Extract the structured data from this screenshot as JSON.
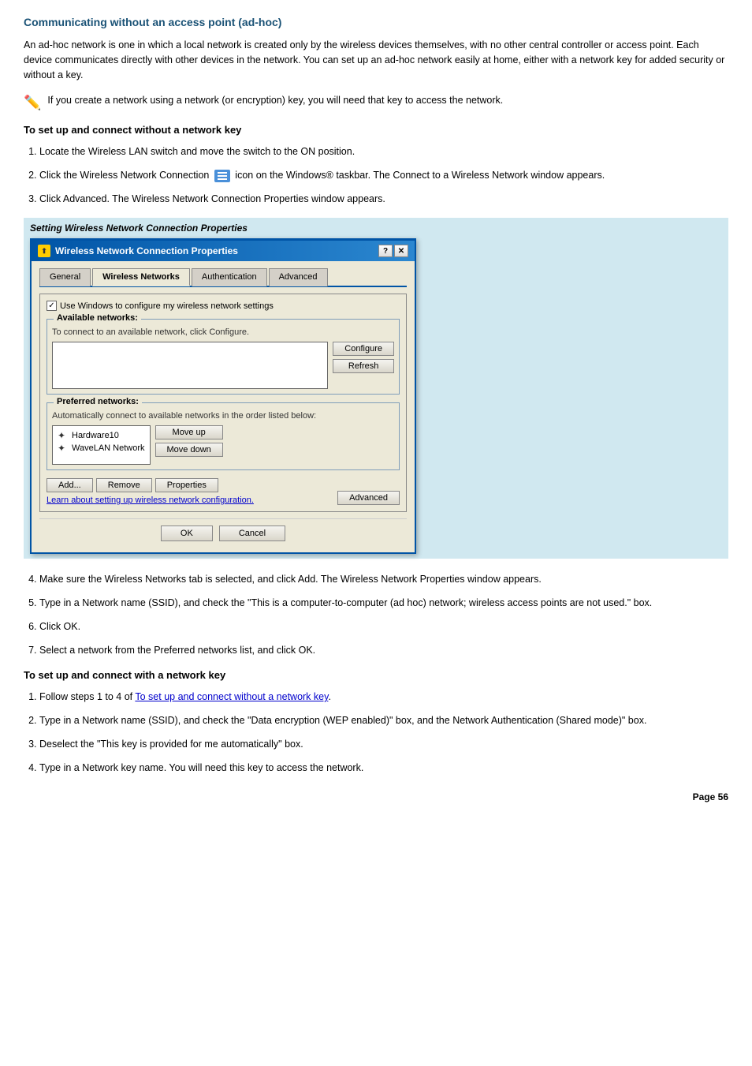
{
  "page": {
    "title": "Communicating without an access point (ad-hoc)",
    "intro": "An ad-hoc network is one in which a local network is created only by the wireless devices themselves, with no other central controller or access point. Each device communicates directly with other devices in the network. You can set up an ad-hoc network easily at home, either with a network key for added security or without a key.",
    "note": "If you create a network using a network (or encryption) key, you will need that key to access the network.",
    "section1_title": "To set up and connect without a network key",
    "steps1": [
      "Locate the Wireless LAN switch and move the switch to the ON position.",
      "Click the Wireless Network Connection  icon on the Windows® taskbar. The Connect to a Wireless Network window appears.",
      "Click Advanced. The Wireless Network Connection Properties window appears."
    ],
    "screenshot_label": "Setting Wireless Network Connection Properties",
    "dialog": {
      "title": "Wireless Network Connection Properties",
      "tabs": [
        "General",
        "Wireless Networks",
        "Authentication",
        "Advanced"
      ],
      "active_tab": "Wireless Networks",
      "checkbox_label": "Use Windows to configure my wireless network settings",
      "checkbox_checked": true,
      "available_group_title": "Available networks:",
      "available_group_desc": "To connect to an available network, click Configure.",
      "configure_btn": "Configure",
      "refresh_btn": "Refresh",
      "preferred_group_title": "Preferred networks:",
      "preferred_group_desc": "Automatically connect to available networks in the order listed below:",
      "networks": [
        "Hardware10",
        "WaveLAN Network"
      ],
      "move_up_btn": "Move up",
      "move_down_btn": "Move down",
      "add_btn": "Add...",
      "remove_btn": "Remove",
      "properties_btn": "Properties",
      "learn_link": "Learn about setting up wireless network configuration.",
      "advanced_btn": "Advanced",
      "ok_btn": "OK",
      "cancel_btn": "Cancel"
    },
    "steps1_cont": [
      "Make sure the Wireless Networks tab is selected, and click Add. The Wireless Network Properties window appears.",
      "Type in a Network name (SSID), and check the \"This is a computer-to-computer (ad hoc) network; wireless access points are not used.\" box.",
      "Click OK.",
      "Select a network from the Preferred networks list, and click OK."
    ],
    "section2_title": "To set up and connect with a network key",
    "steps2": [
      "Follow steps 1 to 4 of To set up and connect without a network key.",
      "Type in a Network name (SSID), and check the \"Data encryption (WEP enabled)\" box, and the Network Authentication (Shared mode)\" box.",
      "Deselect the \"This key is provided for me automatically\" box.",
      "Type in a Network key name. You will need this key to access the network."
    ],
    "page_number": "Page 56"
  }
}
